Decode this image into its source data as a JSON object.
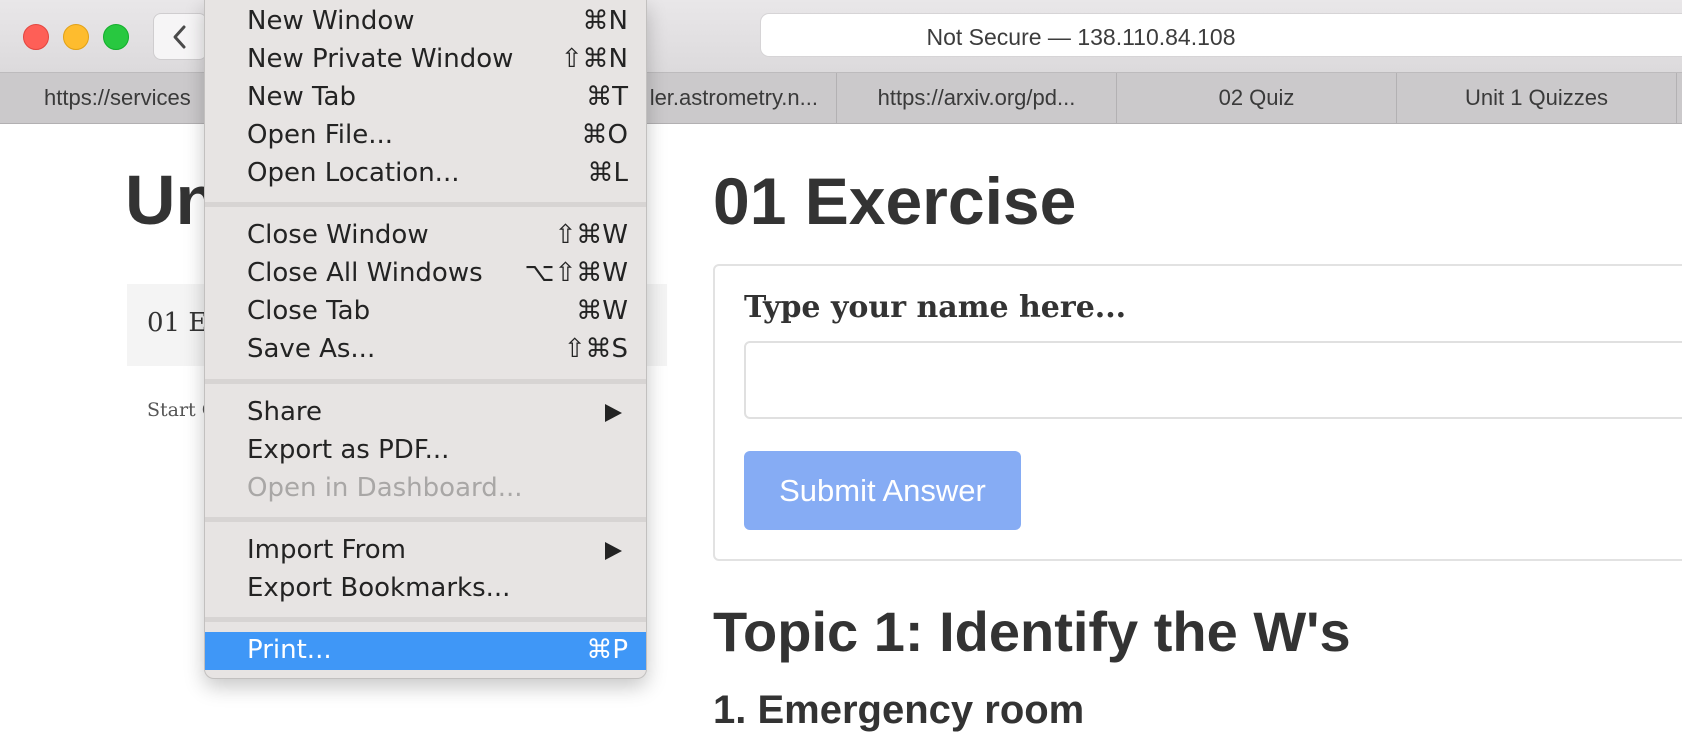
{
  "browser": {
    "address": "Not Secure — 138.110.84.108",
    "tabs": [
      {
        "label": "https://services"
      },
      {
        "label": "ler.astrometry.n..."
      },
      {
        "label": "https://arxiv.org/pd..."
      },
      {
        "label": "02 Quiz"
      },
      {
        "label": "Unit 1 Quizzes"
      }
    ]
  },
  "left": {
    "title": "Un",
    "box_text": "01 E",
    "start_text": "Start C"
  },
  "main": {
    "title": "01 Exercise",
    "name_label": "Type your name here...",
    "name_value": "",
    "submit_label": "Submit Answer",
    "topic_title": "Topic 1: Identify the W's",
    "sub_title": "1. Emergency room"
  },
  "file_menu": {
    "items": [
      {
        "label": "New Window",
        "shortcut": "⌘N"
      },
      {
        "label": "New Private Window",
        "shortcut": "⇧⌘N"
      },
      {
        "label": "New Tab",
        "shortcut": "⌘T"
      },
      {
        "label": "Open File...",
        "shortcut": "⌘O"
      },
      {
        "label": "Open Location...",
        "shortcut": "⌘L"
      },
      {
        "label": "Close Window",
        "shortcut": "⇧⌘W"
      },
      {
        "label": "Close All Windows",
        "shortcut": "⌥⇧⌘W"
      },
      {
        "label": "Close Tab",
        "shortcut": "⌘W"
      },
      {
        "label": "Save As...",
        "shortcut": "⇧⌘S"
      },
      {
        "label": "Share",
        "shortcut": ""
      },
      {
        "label": "Export as PDF...",
        "shortcut": ""
      },
      {
        "label": "Open in Dashboard...",
        "shortcut": ""
      },
      {
        "label": "Import From",
        "shortcut": ""
      },
      {
        "label": "Export Bookmarks...",
        "shortcut": ""
      },
      {
        "label": "Print...",
        "shortcut": "⌘P"
      }
    ]
  },
  "colors": {
    "menu_highlight": "#3f97f7",
    "submit_button": "#86acf4",
    "traffic_red": "#fe5f57",
    "traffic_yellow": "#febc2e",
    "traffic_green": "#28c840"
  }
}
